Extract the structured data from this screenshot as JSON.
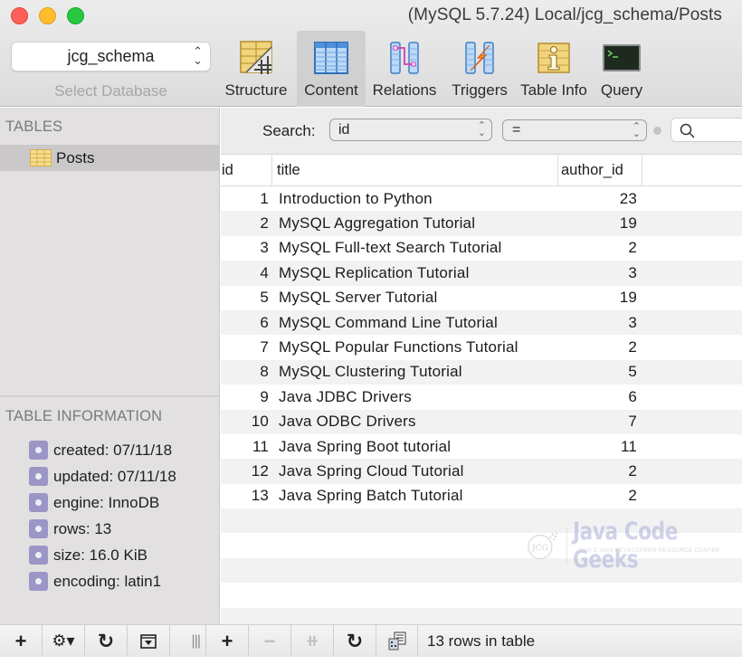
{
  "window": {
    "title": "(MySQL 5.7.24) Local/jcg_schema/Posts"
  },
  "database_selector": {
    "selected": "jcg_schema",
    "label": "Select Database"
  },
  "toolbar": {
    "items": [
      {
        "label": "Structure",
        "icon": "structure-icon"
      },
      {
        "label": "Content",
        "icon": "content-icon",
        "active": true
      },
      {
        "label": "Relations",
        "icon": "relations-icon"
      },
      {
        "label": "Triggers",
        "icon": "triggers-icon"
      },
      {
        "label": "Table Info",
        "icon": "table-info-icon"
      },
      {
        "label": "Query",
        "icon": "query-console-icon"
      }
    ]
  },
  "sidebar": {
    "tables_heading": "TABLES",
    "tables": [
      {
        "name": "Posts",
        "selected": true
      }
    ],
    "info_heading": "TABLE INFORMATION",
    "info": [
      "created: 07/11/18",
      "updated: 07/11/18",
      "engine: InnoDB",
      "rows: 13",
      "size: 16.0 KiB",
      "encoding: latin1"
    ]
  },
  "filter": {
    "label": "Search:",
    "field": "id",
    "operator": "=",
    "value": ""
  },
  "grid": {
    "columns": [
      "id",
      "title",
      "author_id"
    ],
    "rows": [
      {
        "id": "1",
        "title": "Introduction to Python",
        "author_id": "23"
      },
      {
        "id": "2",
        "title": "MySQL Aggregation Tutorial",
        "author_id": "19"
      },
      {
        "id": "3",
        "title": "MySQL Full-text Search Tutorial",
        "author_id": "2"
      },
      {
        "id": "4",
        "title": "MySQL Replication Tutorial",
        "author_id": "3"
      },
      {
        "id": "5",
        "title": "MySQL Server Tutorial",
        "author_id": "19"
      },
      {
        "id": "6",
        "title": "MySQL Command Line Tutorial",
        "author_id": "3"
      },
      {
        "id": "7",
        "title": "MySQL Popular Functions Tutorial",
        "author_id": "2"
      },
      {
        "id": "8",
        "title": "MySQL Clustering Tutorial",
        "author_id": "5"
      },
      {
        "id": "9",
        "title": "Java JDBC Drivers",
        "author_id": "6"
      },
      {
        "id": "10",
        "title": "Java ODBC Drivers",
        "author_id": "7"
      },
      {
        "id": "11",
        "title": "Java Spring Boot tutorial",
        "author_id": "11"
      },
      {
        "id": "12",
        "title": "Java Spring Cloud Tutorial",
        "author_id": "2"
      },
      {
        "id": "13",
        "title": "Java Spring Batch Tutorial",
        "author_id": "2"
      }
    ]
  },
  "watermark": {
    "badge": "JCG",
    "text": "Java Code Geeks",
    "subtitle": "JAVA 2 JAVA DEVELOPERS RESOURCE CENTER"
  },
  "bottombar": {
    "left_buttons": [
      {
        "glyph": "+",
        "name": "add-table-button"
      },
      {
        "glyph": "⚙▾",
        "name": "table-actions-gear-button"
      },
      {
        "glyph": "↻",
        "name": "refresh-tables-button"
      },
      {
        "glyph": "⊡",
        "name": "toggle-table-info-button"
      }
    ],
    "splitter_glyph": "|||",
    "right_buttons": [
      {
        "glyph": "+",
        "name": "add-row-button",
        "enabled": true
      },
      {
        "glyph": "−",
        "name": "delete-row-button",
        "enabled": false
      },
      {
        "glyph": "⧺",
        "name": "duplicate-row-button",
        "enabled": false
      },
      {
        "glyph": "↻",
        "name": "refresh-content-button",
        "enabled": true
      }
    ],
    "status": "13 rows in table"
  },
  "colors": {
    "sidebar_bg": "#e2e0e1",
    "selected_row": "#cac8c9",
    "info_bullet": "#9b96c6",
    "stripe": "#f2f2f2"
  }
}
